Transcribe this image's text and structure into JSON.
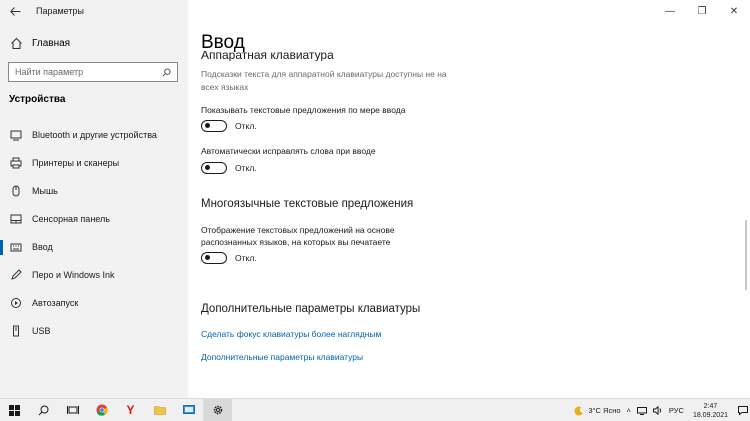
{
  "window": {
    "app_title": "Параметры",
    "controls": {
      "minimize": "—",
      "maximize": "❐",
      "close": "✕"
    }
  },
  "sidebar": {
    "home_label": "Главная",
    "search_placeholder": "Найти параметр",
    "section_title": "Устройства",
    "items": [
      {
        "label": "Bluetooth и другие устройства",
        "icon": "bluetooth-icon"
      },
      {
        "label": "Принтеры и сканеры",
        "icon": "printer-icon"
      },
      {
        "label": "Мышь",
        "icon": "mouse-icon"
      },
      {
        "label": "Сенсорная панель",
        "icon": "touchpad-icon"
      },
      {
        "label": "Ввод",
        "icon": "keyboard-icon",
        "active": true
      },
      {
        "label": "Перо и Windows Ink",
        "icon": "pen-icon"
      },
      {
        "label": "Автозапуск",
        "icon": "autoplay-icon"
      },
      {
        "label": "USB",
        "icon": "usb-icon"
      }
    ]
  },
  "main": {
    "title": "Ввод",
    "cut_heading": "Аппаратная клавиатура",
    "hw_description": "Подсказки текста для аппаратной клавиатуры доступны не на всех языках",
    "settings": [
      {
        "label": "Показывать текстовые предложения по мере ввода",
        "state": "Откл."
      },
      {
        "label": "Автоматически исправлять слова при вводе",
        "state": "Откл."
      }
    ],
    "multilang_heading": "Многоязычные текстовые предложения",
    "multilang_setting": {
      "label": "Отображение текстовых предложений на основе распознанных языков, на которых вы печатаете",
      "state": "Откл."
    },
    "advanced_heading": "Дополнительные параметры клавиатуры",
    "links": [
      "Сделать фокус клавиатуры более наглядным",
      "Дополнительные параметры клавиатуры"
    ]
  },
  "taskbar": {
    "weather": "3°C Ясно",
    "language": "РУС",
    "time": "2:47",
    "date": "18.09.2021"
  },
  "colors": {
    "accent": "#0063b1",
    "link": "#0063b1"
  }
}
